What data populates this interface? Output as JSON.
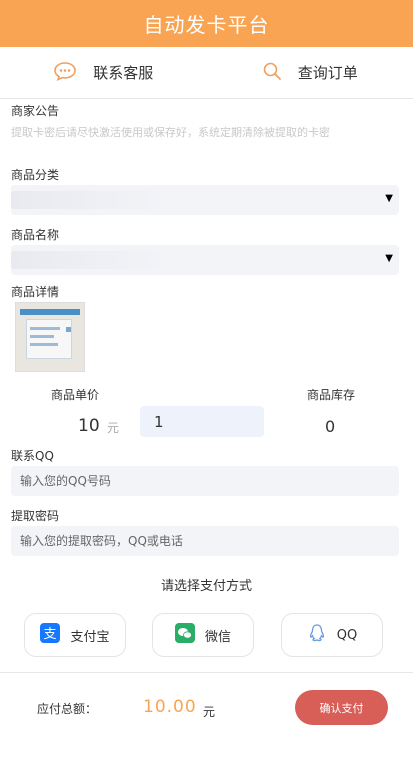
{
  "header": {
    "title": "自动发卡平台"
  },
  "nav": {
    "contact_label": "联系客服",
    "query_label": "查询订单"
  },
  "notice": {
    "label": "商家公告",
    "text": "提取卡密后请尽快激活使用或保存好，系统定期清除被提取的卡密"
  },
  "category": {
    "label": "商品分类"
  },
  "product_name": {
    "label": "商品名称"
  },
  "details": {
    "label": "商品详情"
  },
  "pricing": {
    "unit_price_label": "商品单价",
    "unit_price": "10",
    "unit_yuan": "元",
    "quantity": "1",
    "stock_label": "商品库存",
    "stock": "0"
  },
  "contact_qq": {
    "label": "联系QQ",
    "placeholder": "输入您的QQ号码"
  },
  "extract_password": {
    "label": "提取密码",
    "placeholder": "输入您的提取密码，QQ或电话"
  },
  "payment": {
    "title": "请选择支付方式",
    "alipay": "支付宝",
    "wechat": "微信",
    "qq": "QQ"
  },
  "footer": {
    "total_label": "应付总额：",
    "total_value": "10.00",
    "total_yuan": "元",
    "confirm_label": "确认支付"
  },
  "colors": {
    "brand": "#f9a453",
    "confirm": "#d85e58",
    "alipay": "#1677ff",
    "wechat": "#2aae67",
    "qq": "#6a9be0"
  }
}
